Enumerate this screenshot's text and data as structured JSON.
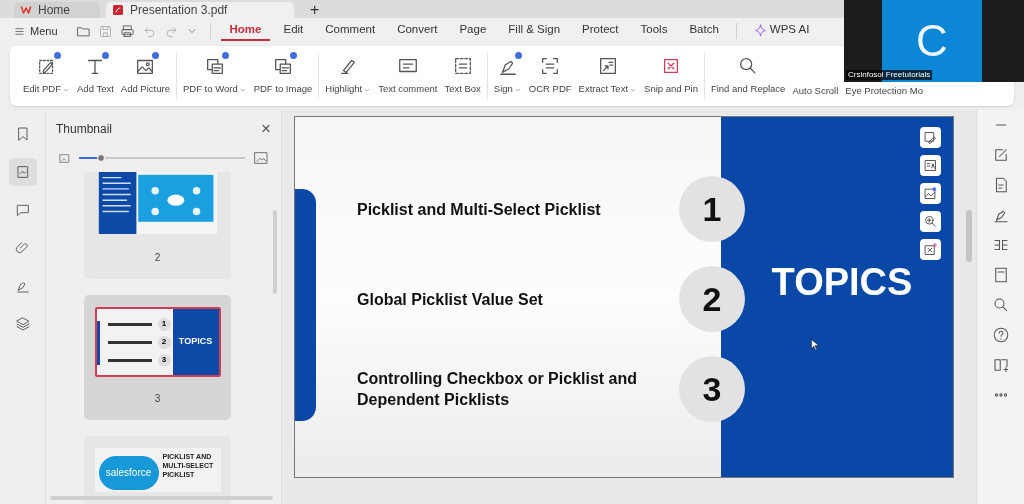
{
  "title_bar": {
    "tabs": [
      {
        "label": "Home",
        "kind": "home",
        "selected": false
      },
      {
        "label": "Presentation 3.pdf",
        "kind": "pdf",
        "selected": true
      }
    ],
    "new_tab": "+"
  },
  "menu": {
    "label": "Menu"
  },
  "ribbon_tabs": [
    {
      "label": "Home",
      "selected": true,
      "kind": "text"
    },
    {
      "label": "Edit",
      "selected": false,
      "kind": "text"
    },
    {
      "label": "Comment",
      "selected": false,
      "kind": "text"
    },
    {
      "label": "Convert",
      "selected": false,
      "kind": "text"
    },
    {
      "label": "Page",
      "selected": false,
      "kind": "text"
    },
    {
      "label": "Fill & Sign",
      "selected": false,
      "kind": "text"
    },
    {
      "label": "Protect",
      "selected": false,
      "kind": "text"
    },
    {
      "label": "Tools",
      "selected": false,
      "kind": "text"
    },
    {
      "label": "Batch",
      "selected": false,
      "kind": "text"
    },
    {
      "label": "WPS AI",
      "selected": false,
      "kind": "ai"
    }
  ],
  "ribbon": [
    [
      {
        "label": "Edit PDF",
        "dropdown": true,
        "badge": true
      },
      {
        "label": "Add Text",
        "dropdown": false,
        "badge": true
      },
      {
        "label": "Add Picture",
        "dropdown": false,
        "badge": true
      }
    ],
    [
      {
        "label": "PDF to Word",
        "dropdown": true,
        "badge": true
      },
      {
        "label": "PDF to Image",
        "dropdown": false,
        "badge": true
      }
    ],
    [
      {
        "label": "Highlight",
        "dropdown": true,
        "badge": false
      },
      {
        "label": "Text comment",
        "dropdown": false,
        "badge": false
      },
      {
        "label": "Text Box",
        "dropdown": false,
        "badge": false
      }
    ],
    [
      {
        "label": "Sign",
        "dropdown": true,
        "badge": true
      },
      {
        "label": "OCR PDF",
        "dropdown": false,
        "badge": false
      },
      {
        "label": "Extract Text",
        "dropdown": true,
        "badge": false
      },
      {
        "label": "Snip and Pin",
        "dropdown": false,
        "badge": false
      }
    ],
    [
      {
        "label": "Find and Replace",
        "dropdown": false,
        "badge": false
      },
      {
        "label": "Auto Scroll",
        "dropdown": false
      },
      {
        "label": "Eye Protection Mo",
        "dropdown": false
      }
    ]
  ],
  "video_tile": {
    "initial": "C",
    "name": "Crsinfosol Freetutorials"
  },
  "left_rail": [
    {
      "kind": "bookmark",
      "selected": false
    },
    {
      "kind": "thumbnail",
      "selected": true
    },
    {
      "kind": "comment",
      "selected": false
    },
    {
      "kind": "attachment",
      "selected": false
    },
    {
      "kind": "signature",
      "selected": false
    },
    {
      "kind": "layers",
      "selected": false
    }
  ],
  "thumbnail_panel": {
    "title": "Thumbnail",
    "close": "×",
    "size": {
      "level": 0.13
    },
    "pages": [
      {
        "kind": "overview",
        "number": "2",
        "selected": false
      },
      {
        "kind": "topics",
        "number": "3",
        "selected": true,
        "heading": "TOPICS",
        "markers": [
          "1",
          "2",
          "3"
        ]
      },
      {
        "kind": "detail",
        "selected": false,
        "logo": "salesforce",
        "heading": "PICKLIST AND MULTI-SELECT PICKLIST"
      }
    ]
  },
  "slide": {
    "heading": "TOPICS",
    "items": [
      {
        "number": "1",
        "text": "Picklist and Multi-Select Picklist"
      },
      {
        "number": "2",
        "text": "Global Picklist Value Set"
      },
      {
        "number": "3",
        "text": "Controlling Checkbox or Picklist and Dependent Picklists"
      }
    ]
  }
}
